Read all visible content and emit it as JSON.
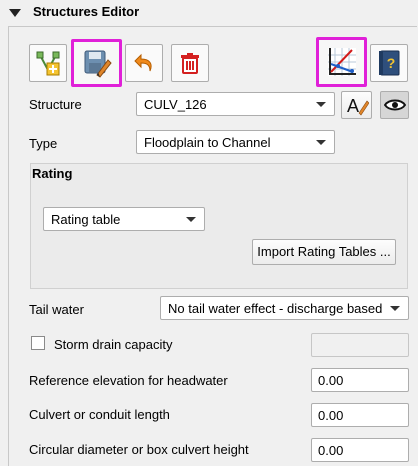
{
  "header": {
    "title": "Structures Editor"
  },
  "toolbar": {
    "buttons": [
      {
        "icon": "add-structure-icon"
      },
      {
        "icon": "save-edit-icon",
        "highlighted": true
      },
      {
        "icon": "undo-icon"
      },
      {
        "icon": "delete-icon"
      },
      {
        "icon": "rating-plot-icon",
        "highlighted": true
      },
      {
        "icon": "help-book-icon"
      }
    ],
    "highlight_color": "#e020d8"
  },
  "structure": {
    "label": "Structure",
    "value": "CULV_126"
  },
  "type": {
    "label": "Type",
    "value": "Floodplain to Channel"
  },
  "rating": {
    "title": "Rating",
    "method": "Rating table",
    "import_button": "Import Rating Tables ..."
  },
  "tail_water": {
    "label": "Tail water",
    "value": "No tail water effect - discharge based c"
  },
  "storm_drain": {
    "label": "Storm drain capacity",
    "checked": false,
    "value": ""
  },
  "reference_elevation": {
    "label": "Reference elevation for headwater",
    "value": "0.00"
  },
  "culvert_length": {
    "label": "Culvert or conduit length",
    "value": "0.00"
  },
  "diameter": {
    "label": "Circular diameter or box culvert height",
    "value": "0.00"
  }
}
